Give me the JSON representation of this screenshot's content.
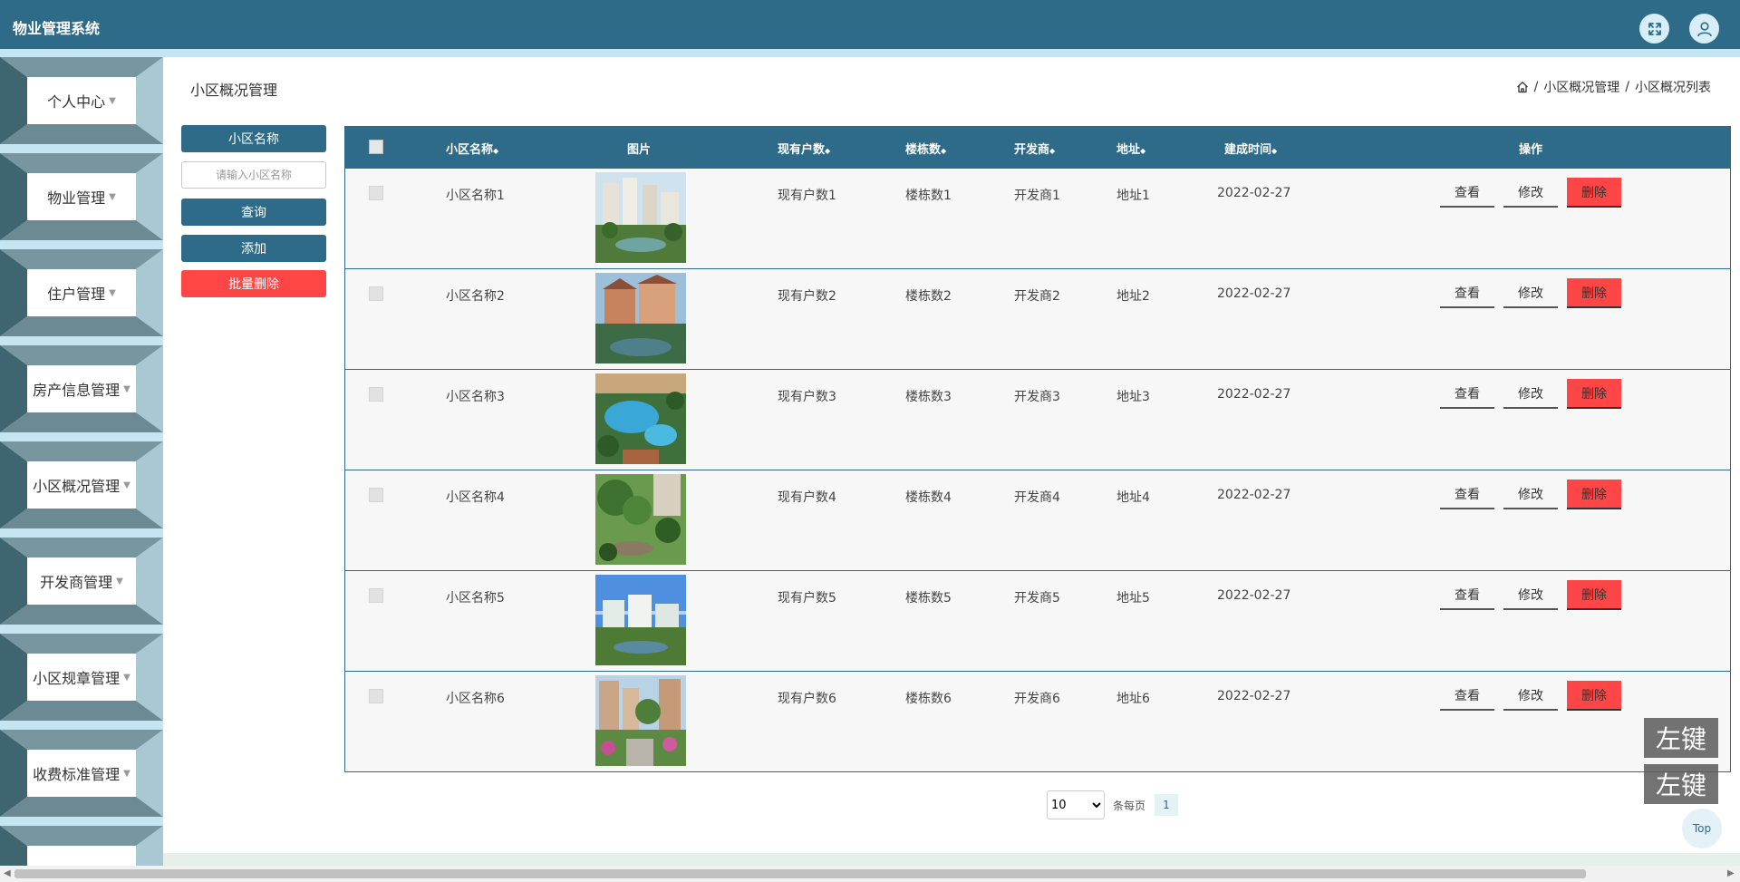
{
  "header": {
    "title": "物业管理系统",
    "fullscreen_icon": "expand-icon",
    "user_icon": "user-icon"
  },
  "sidebar": {
    "items": [
      {
        "label": "个人中心"
      },
      {
        "label": "物业管理"
      },
      {
        "label": "住户管理"
      },
      {
        "label": "房产信息管理"
      },
      {
        "label": "小区概况管理"
      },
      {
        "label": "开发商管理"
      },
      {
        "label": "小区规章管理"
      },
      {
        "label": "收费标准管理"
      },
      {
        "label": ""
      }
    ]
  },
  "page": {
    "title": "小区概况管理",
    "breadcrumb": {
      "home_icon": "home-icon",
      "sep": "/",
      "level1": "小区概况管理",
      "level2": "小区概况列表"
    }
  },
  "search": {
    "field_label": "小区名称",
    "placeholder": "请输入小区名称",
    "value": "",
    "query_label": "查询",
    "add_label": "添加",
    "batch_delete_label": "批量删除"
  },
  "table": {
    "columns": [
      "小区名称",
      "图片",
      "现有户数",
      "楼栋数",
      "开发商",
      "地址",
      "建成时间",
      "操作"
    ],
    "sort_glyph": "◆",
    "rows": [
      {
        "name": "小区名称1",
        "households": "现有户数1",
        "buildings": "楼栋数1",
        "developer": "开发商1",
        "address": "地址1",
        "built": "2022-02-27"
      },
      {
        "name": "小区名称2",
        "households": "现有户数2",
        "buildings": "楼栋数2",
        "developer": "开发商2",
        "address": "地址2",
        "built": "2022-02-27"
      },
      {
        "name": "小区名称3",
        "households": "现有户数3",
        "buildings": "楼栋数3",
        "developer": "开发商3",
        "address": "地址3",
        "built": "2022-02-27"
      },
      {
        "name": "小区名称4",
        "households": "现有户数4",
        "buildings": "楼栋数4",
        "developer": "开发商4",
        "address": "地址4",
        "built": "2022-02-27"
      },
      {
        "name": "小区名称5",
        "households": "现有户数5",
        "buildings": "楼栋数5",
        "developer": "开发商5",
        "address": "地址5",
        "built": "2022-02-27"
      },
      {
        "name": "小区名称6",
        "households": "现有户数6",
        "buildings": "楼栋数6",
        "developer": "开发商6",
        "address": "地址6",
        "built": "2022-02-27"
      }
    ],
    "actions": {
      "view": "查看",
      "edit": "修改",
      "delete": "删除"
    }
  },
  "pagination": {
    "page_size": "10",
    "page_size_options": [
      "10"
    ],
    "per_page_label": "条每页",
    "current_page": "1"
  },
  "floating": {
    "key_label_1": "左键",
    "key_label_2": "左键",
    "top_label": "Top"
  },
  "colors": {
    "primary": "#2e6b88",
    "danger": "#ff4646",
    "sidebar_bg": "#c4e6f2",
    "header_strip": "#c4e6f2"
  }
}
